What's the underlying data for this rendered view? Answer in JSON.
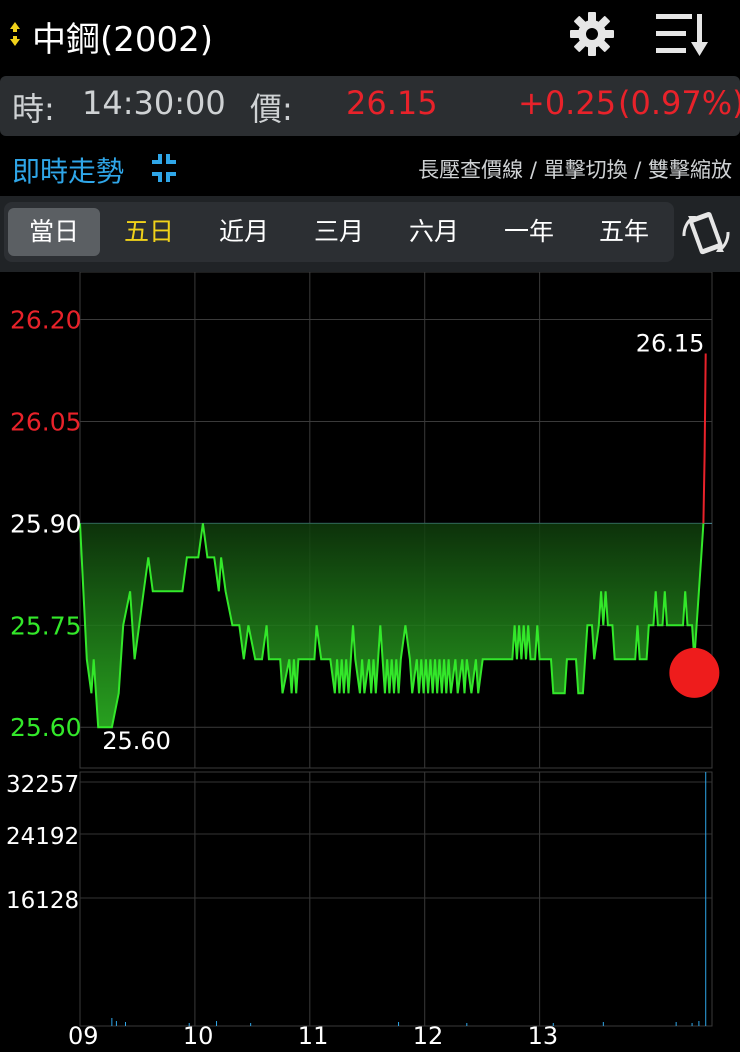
{
  "header": {
    "title": "中鋼(2002)"
  },
  "quote": {
    "time_label": "時:",
    "time": "14:30:00",
    "price_label": "價:",
    "price": "26.15",
    "change": "+0.25",
    "change_pct": "(0.97%)"
  },
  "mode": {
    "live_label": "即時走勢",
    "hint": "長壓查價線 / 單擊切換 / 雙擊縮放"
  },
  "tabs": [
    {
      "label": "當日"
    },
    {
      "label": "五日"
    },
    {
      "label": "近月"
    },
    {
      "label": "三月"
    },
    {
      "label": "六月"
    },
    {
      "label": "一年"
    },
    {
      "label": "五年"
    }
  ],
  "colors": {
    "up": "#e8222a",
    "line": "#33e82a",
    "accent": "#2fa6e8",
    "tab_selected_alt": "#f1d21a"
  },
  "chart_data": {
    "type": "area",
    "reference_price": 25.9,
    "price_ticks": [
      {
        "label": "26.20",
        "value": 26.2,
        "color": "up"
      },
      {
        "label": "26.05",
        "value": 26.05,
        "color": "up"
      },
      {
        "label": "25.90",
        "value": 25.9,
        "color": "flat"
      },
      {
        "label": "25.75",
        "value": 25.75,
        "color": "down"
      },
      {
        "label": "25.60",
        "value": 25.6,
        "color": "down"
      }
    ],
    "ylim": [
      25.54,
      26.27
    ],
    "volume_ticks": [
      "32257",
      "24192",
      "16128"
    ],
    "volume_max": 32257,
    "x_ticks": [
      "09",
      "10",
      "11",
      "12",
      "13"
    ],
    "x_range": [
      "09:00",
      "13:30"
    ],
    "annotations": {
      "high_label": "26.15",
      "low_label": "25.60"
    },
    "price_series": [
      [
        0,
        25.9
      ],
      [
        3,
        25.7
      ],
      [
        5,
        25.65
      ],
      [
        6,
        25.7
      ],
      [
        8,
        25.6
      ],
      [
        11,
        25.6
      ],
      [
        14,
        25.6
      ],
      [
        17,
        25.65
      ],
      [
        19,
        25.75
      ],
      [
        22,
        25.8
      ],
      [
        24,
        25.7
      ],
      [
        26,
        25.75
      ],
      [
        28,
        25.8
      ],
      [
        30,
        25.85
      ],
      [
        32,
        25.8
      ],
      [
        37,
        25.8
      ],
      [
        45,
        25.8
      ],
      [
        47,
        25.85
      ],
      [
        50,
        25.85
      ],
      [
        52,
        25.85
      ],
      [
        54,
        25.9
      ],
      [
        56,
        25.85
      ],
      [
        59,
        25.85
      ],
      [
        61,
        25.8
      ],
      [
        62,
        25.85
      ],
      [
        64,
        25.8
      ],
      [
        67,
        25.75
      ],
      [
        70,
        25.75
      ],
      [
        72,
        25.7
      ],
      [
        74,
        25.75
      ],
      [
        77,
        25.7
      ],
      [
        80,
        25.7
      ],
      [
        82,
        25.75
      ],
      [
        83,
        25.7
      ],
      [
        85,
        25.7
      ],
      [
        88,
        25.7
      ],
      [
        89,
        25.65
      ],
      [
        92,
        25.7
      ],
      [
        93,
        25.65
      ],
      [
        94,
        25.7
      ],
      [
        95,
        25.65
      ],
      [
        96,
        25.7
      ],
      [
        100,
        25.7
      ],
      [
        103,
        25.7
      ],
      [
        104,
        25.75
      ],
      [
        106,
        25.7
      ],
      [
        110,
        25.7
      ],
      [
        112,
        25.65
      ],
      [
        113,
        25.7
      ],
      [
        114,
        25.65
      ],
      [
        115,
        25.7
      ],
      [
        116,
        25.65
      ],
      [
        117,
        25.7
      ],
      [
        118,
        25.65
      ],
      [
        119,
        25.7
      ],
      [
        120,
        25.75
      ],
      [
        121,
        25.7
      ],
      [
        123,
        25.65
      ],
      [
        124,
        25.7
      ],
      [
        125,
        25.65
      ],
      [
        127,
        25.7
      ],
      [
        128,
        25.65
      ],
      [
        129,
        25.7
      ],
      [
        130,
        25.65
      ],
      [
        131,
        25.7
      ],
      [
        132,
        25.75
      ],
      [
        134,
        25.65
      ],
      [
        135,
        25.7
      ],
      [
        136,
        25.65
      ],
      [
        137,
        25.7
      ],
      [
        138,
        25.65
      ],
      [
        139,
        25.7
      ],
      [
        140,
        25.65
      ],
      [
        141,
        25.7
      ],
      [
        143,
        25.75
      ],
      [
        145,
        25.7
      ],
      [
        146,
        25.65
      ],
      [
        148,
        25.7
      ],
      [
        149,
        25.65
      ],
      [
        150,
        25.7
      ],
      [
        151,
        25.65
      ],
      [
        152,
        25.7
      ],
      [
        153,
        25.65
      ],
      [
        154,
        25.7
      ],
      [
        155,
        25.65
      ],
      [
        156,
        25.7
      ],
      [
        157,
        25.65
      ],
      [
        158,
        25.7
      ],
      [
        159,
        25.65
      ],
      [
        160,
        25.7
      ],
      [
        161,
        25.65
      ],
      [
        162,
        25.7
      ],
      [
        163,
        25.65
      ],
      [
        165,
        25.7
      ],
      [
        166,
        25.65
      ],
      [
        168,
        25.7
      ],
      [
        169,
        25.65
      ],
      [
        170,
        25.7
      ],
      [
        172,
        25.65
      ],
      [
        174,
        25.7
      ],
      [
        175,
        25.65
      ],
      [
        177,
        25.7
      ],
      [
        186,
        25.7
      ],
      [
        190,
        25.7
      ],
      [
        191,
        25.75
      ],
      [
        192,
        25.7
      ],
      [
        193,
        25.75
      ],
      [
        194,
        25.7
      ],
      [
        195,
        25.75
      ],
      [
        196,
        25.7
      ],
      [
        197,
        25.75
      ],
      [
        198,
        25.7
      ],
      [
        200,
        25.7
      ],
      [
        201,
        25.75
      ],
      [
        202,
        25.7
      ],
      [
        207,
        25.7
      ],
      [
        208,
        25.65
      ],
      [
        213,
        25.65
      ],
      [
        214,
        25.7
      ],
      [
        218,
        25.7
      ],
      [
        219,
        25.65
      ],
      [
        221,
        25.65
      ],
      [
        222,
        25.7
      ],
      [
        223,
        25.75
      ],
      [
        225,
        25.75
      ],
      [
        226,
        25.7
      ],
      [
        228,
        25.75
      ],
      [
        229,
        25.8
      ],
      [
        230,
        25.75
      ],
      [
        231,
        25.8
      ],
      [
        232,
        25.75
      ],
      [
        234,
        25.75
      ],
      [
        235,
        25.7
      ],
      [
        244,
        25.7
      ],
      [
        245,
        25.75
      ],
      [
        246,
        25.7
      ],
      [
        249,
        25.7
      ],
      [
        250,
        25.75
      ],
      [
        252,
        25.75
      ],
      [
        253,
        25.8
      ],
      [
        254,
        25.75
      ],
      [
        256,
        25.75
      ],
      [
        257,
        25.8
      ],
      [
        258,
        25.75
      ],
      [
        265,
        25.75
      ],
      [
        266,
        25.8
      ],
      [
        267,
        25.75
      ],
      [
        269,
        25.75
      ],
      [
        270,
        25.7
      ],
      [
        271,
        25.75
      ],
      [
        272,
        25.8
      ],
      [
        273,
        25.85
      ],
      [
        274,
        25.9
      ],
      [
        274.5,
        26.0
      ],
      [
        275,
        26.15
      ]
    ],
    "current_marker_value": 25.68
  }
}
